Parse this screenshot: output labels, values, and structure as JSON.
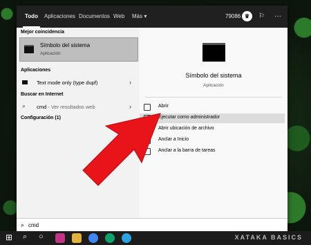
{
  "tabs": [
    {
      "label": "Todo"
    },
    {
      "label": "Aplicaciones"
    },
    {
      "label": "Documentos"
    },
    {
      "label": "Web"
    },
    {
      "label": "Más ▾"
    }
  ],
  "topbar": {
    "points": "79086",
    "more": "···"
  },
  "left": {
    "best_match_header": "Mejor coincidencia",
    "best_match": {
      "title": "Símbolo del sistema",
      "subtitle": "Aplicación"
    },
    "apps_header": "Aplicaciones",
    "apps": [
      {
        "label": "Text mode only (type dupf)"
      }
    ],
    "web_header": "Buscar en Internet",
    "web": {
      "label": "cmd",
      "hint": " - Ver resultados web"
    },
    "settings_header": "Configuración (1)"
  },
  "right": {
    "title": "Símbolo del sistema",
    "subtitle": "Aplicación",
    "actions": [
      {
        "label": "Abrir"
      },
      {
        "label": "Ejecutar como administrador"
      },
      {
        "label": "Abrir ubicación de archivo"
      },
      {
        "label": "Anclar a Inicio"
      },
      {
        "label": "Anclar a la barra de tareas"
      }
    ]
  },
  "search": {
    "value": "cmd"
  },
  "watermark": "XATAKA BASICS",
  "colors": {
    "arrow": "#e8141a",
    "topbar": "#202020",
    "highlight": "#dcdcdc"
  }
}
